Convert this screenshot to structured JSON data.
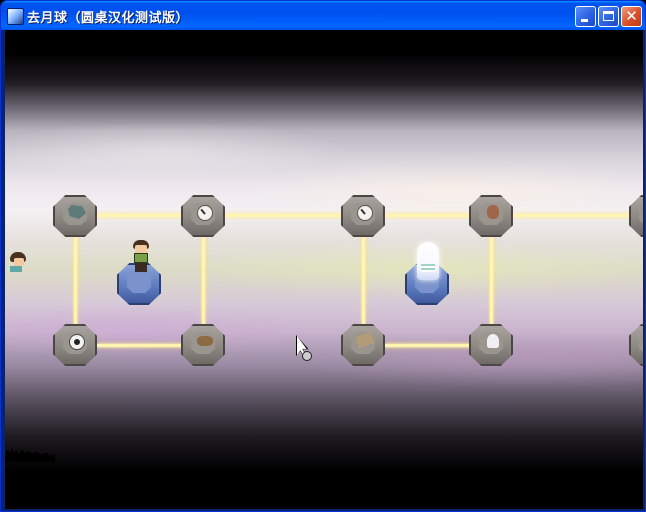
{
  "window": {
    "title": "去月球（圆桌汉化测试版）",
    "buttons": {
      "minimize": "minimize",
      "maximize": "maximize",
      "close": "close"
    }
  },
  "scene": {
    "nodes": [
      {
        "id": "top-1",
        "icon": "shard-icon",
        "style": "stone"
      },
      {
        "id": "top-2",
        "icon": "clock-icon",
        "style": "stone"
      },
      {
        "id": "top-3",
        "icon": "clock-icon",
        "style": "stone"
      },
      {
        "id": "top-4",
        "icon": "bag-icon",
        "style": "stone"
      },
      {
        "id": "top-5",
        "icon": "",
        "style": "stone"
      },
      {
        "id": "mid-1",
        "icon": "",
        "style": "blue"
      },
      {
        "id": "mid-2",
        "icon": "",
        "style": "blue"
      },
      {
        "id": "bottom-1",
        "icon": "ball-icon",
        "style": "stone"
      },
      {
        "id": "bottom-2",
        "icon": "snake-icon",
        "style": "stone"
      },
      {
        "id": "bottom-3",
        "icon": "book-icon",
        "style": "stone"
      },
      {
        "id": "bottom-4",
        "icon": "squid-icon",
        "style": "stone"
      },
      {
        "id": "bottom-5",
        "icon": "",
        "style": "stone"
      }
    ],
    "characters": [
      "boy-character",
      "ghost-character",
      "peeking-character"
    ],
    "colors": {
      "link_glow": "#fff4b0",
      "stone": "#8e8883",
      "blue_pedestal": "#5c79bd",
      "titlebar": "#0050ee"
    }
  }
}
